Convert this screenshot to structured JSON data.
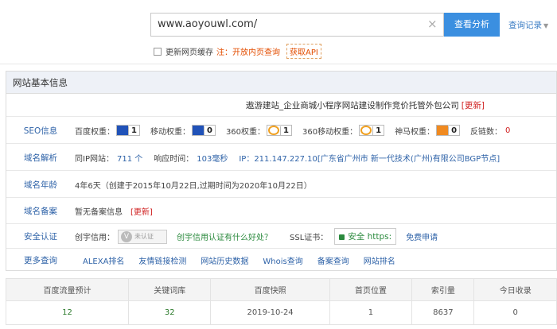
{
  "search": {
    "value": "www.aoyouwl.com/",
    "clear_icon": "×",
    "button": "查看分析",
    "history": "查询记录"
  },
  "options": {
    "checkbox_label": "更新网页缓存",
    "note": "注：开放内页查询",
    "api": "获取API"
  },
  "panel": {
    "title": "网站基本信息",
    "site_title": "遨游建站_企业商城小程序网站建设制作竞价托管外包公司",
    "refresh": "[更新]",
    "seo": {
      "label": "SEO信息",
      "baidu": "百度权重：",
      "baidu_val": "1",
      "mobile": "移动权重：",
      "mobile_val": "0",
      "w360": "360权重：",
      "w360_val": "1",
      "w360m": "360移动权重：",
      "w360m_val": "1",
      "shenma": "神马权重：",
      "shenma_val": "0",
      "backlinks": "反链数：",
      "backlinks_val": "0"
    },
    "domain": {
      "label": "域名解析",
      "same_ip": "同IP网站：",
      "same_ip_val": "711 个",
      "response": "响应时间：",
      "response_val": "103毫秒",
      "ip": "IP：211.147.227.10[广东省广州市 新一代技术(广州)有限公司BGP节点]"
    },
    "age": {
      "label": "域名年龄",
      "value": "4年6天（创建于2015年10月22日,过期时间为2020年10月22日）"
    },
    "icp": {
      "label": "域名备案",
      "value": "暂无备案信息",
      "refresh": "[更新]"
    },
    "security": {
      "label": "安全认证",
      "credit": "创宇信用：",
      "credit_badge": "未认证",
      "credit_link": "创宇信用认证有什么好处？",
      "ssl": "SSL证书：",
      "ssl_badge": "安全 https:",
      "free": "免费申请"
    },
    "more": {
      "label": "更多查询",
      "links": [
        "ALEXA排名",
        "友情链接检测",
        "网站历史数据",
        "Whois查询",
        "备案查询",
        "网站排名"
      ]
    }
  },
  "stats": {
    "headers": [
      "百度流量预计",
      "关键词库",
      "百度快照",
      "首页位置",
      "索引量",
      "今日收录"
    ],
    "values": [
      "12",
      "32",
      "2019-10-24",
      "1",
      "8637",
      "0"
    ]
  }
}
